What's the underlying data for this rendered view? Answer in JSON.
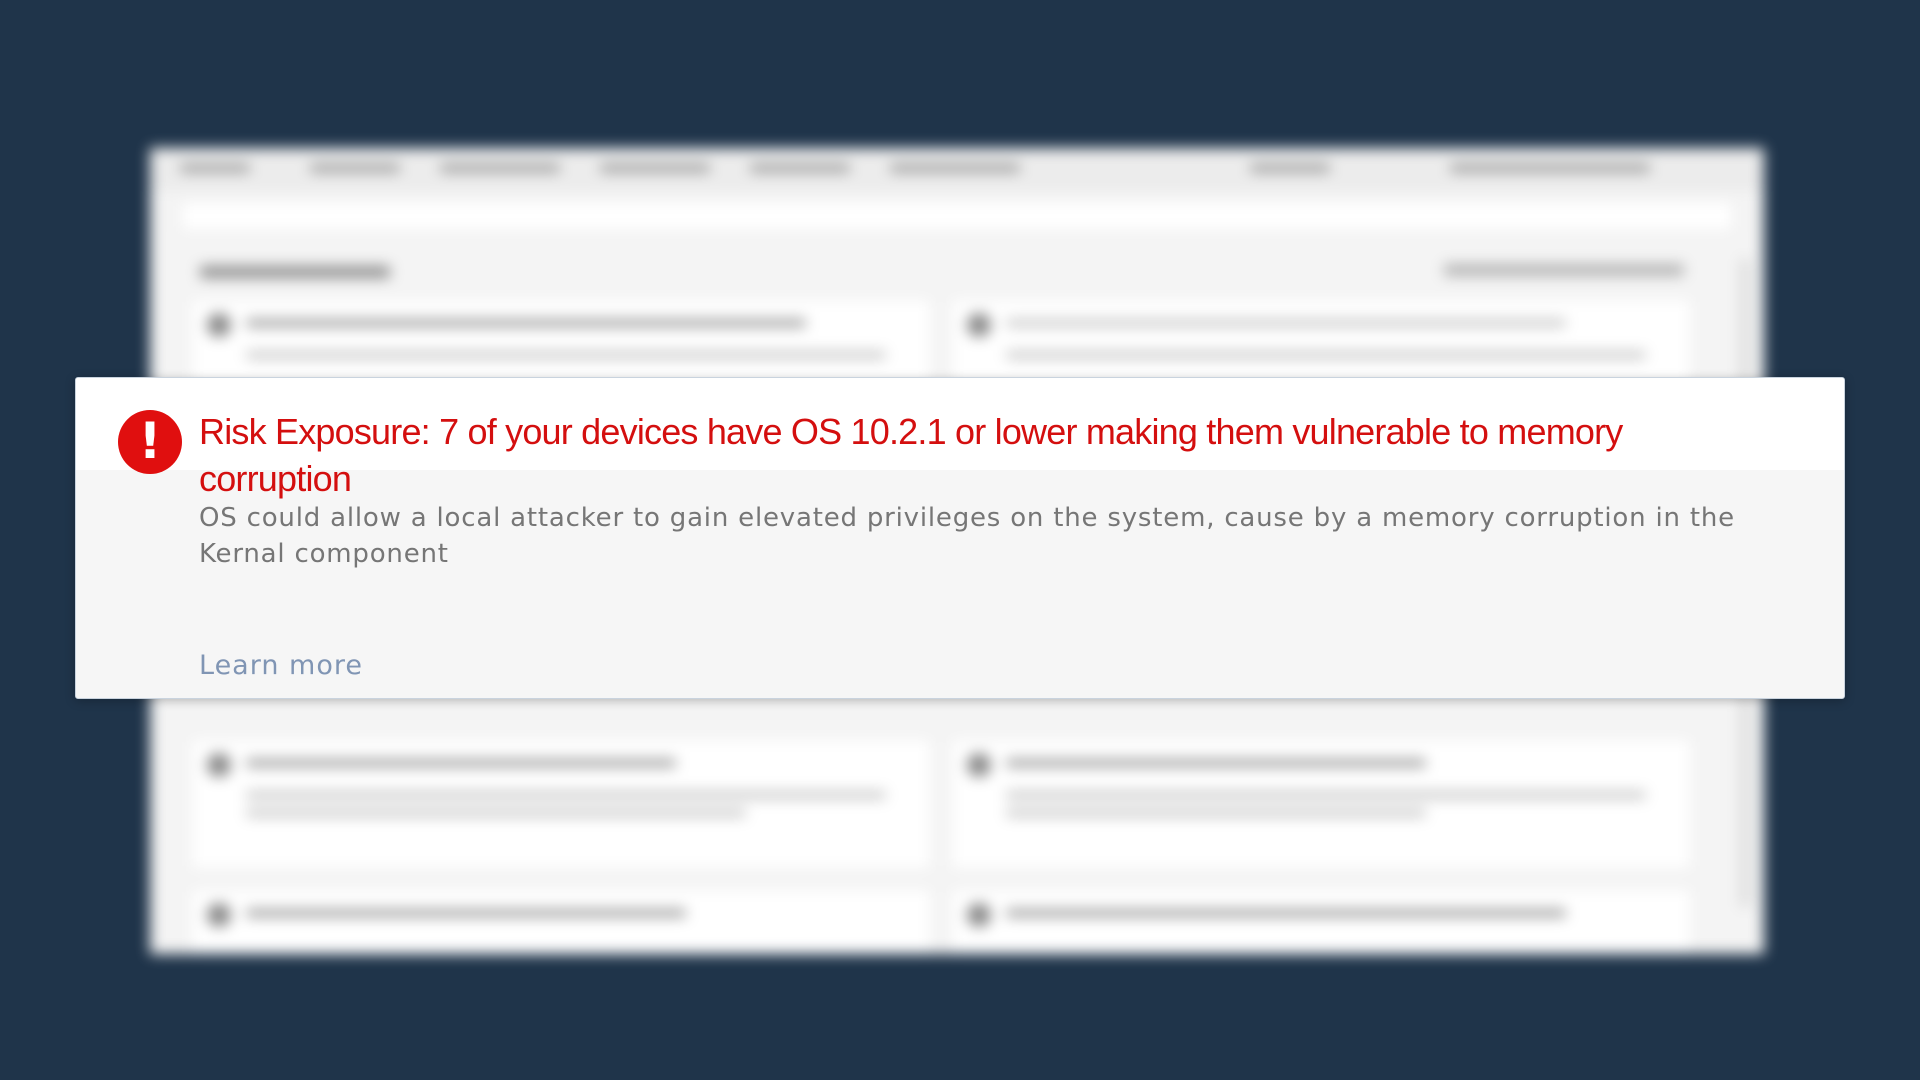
{
  "alert": {
    "icon": "exclamation-icon",
    "icon_glyph": "!",
    "icon_color": "#e00f0f",
    "title": "Risk Exposure:  7 of your devices have OS 10.2.1 or lower making them vulnerable to memory corruption",
    "title_color": "#d40f0f",
    "description": "OS could allow a local attacker to gain elevated privileges on the system, cause by a memory corruption in the Kernal component",
    "link_label": "Learn more",
    "link_color": "#8095b4"
  },
  "colors": {
    "backdrop": "#1f344a",
    "panel": "#f6f6f6"
  }
}
